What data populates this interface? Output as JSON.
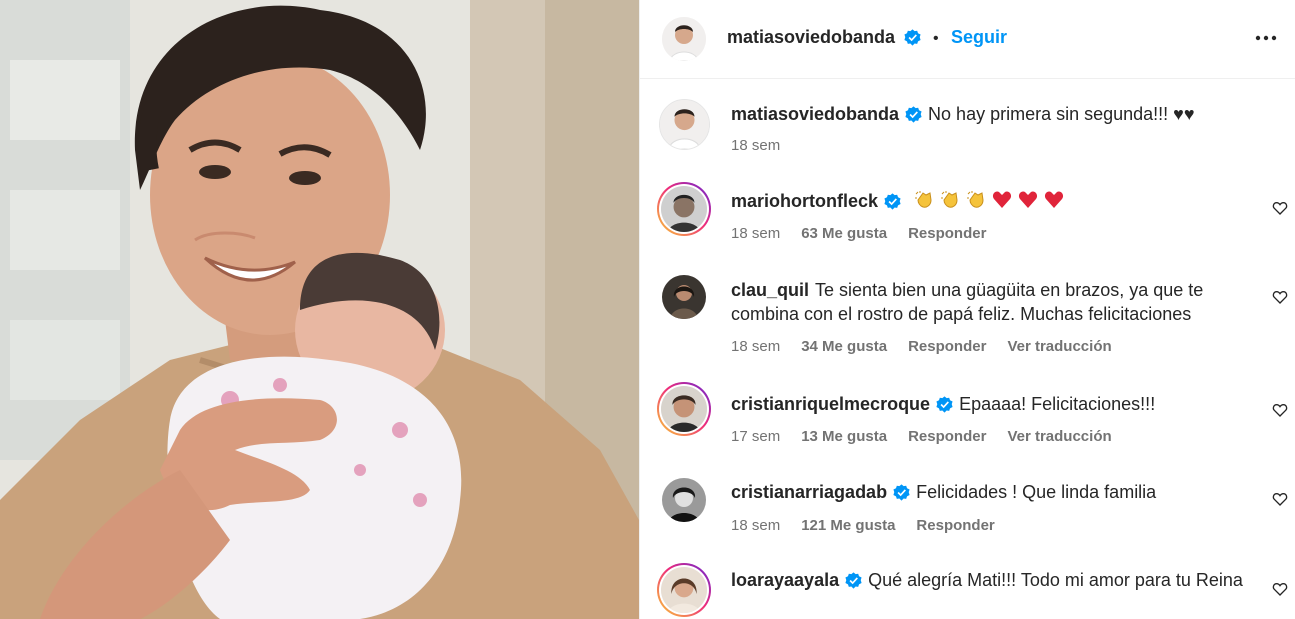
{
  "post": {
    "author": "matiasoviedobanda",
    "follow_label": "Seguir",
    "separator": "•",
    "caption": "No hay primera sin segunda!!! ♥♥",
    "time": "18 sem",
    "photo_alt": "Photo"
  },
  "comments": [
    {
      "username": "mariohortonfleck",
      "verified": true,
      "text": "",
      "emoji": [
        "clapping-hands",
        "clapping-hands",
        "clapping-hands",
        "red-heart",
        "red-heart",
        "red-heart"
      ],
      "time": "18 sem",
      "likes": "63 Me gusta",
      "reply": "Responder",
      "translate": ""
    },
    {
      "username": "clau_quil",
      "verified": false,
      "text": "Te sienta bien una güagüita en brazos, ya que te combina con el rostro de papá feliz. Muchas felicitaciones",
      "time": "18 sem",
      "likes": "34 Me gusta",
      "reply": "Responder",
      "translate": "Ver traducción"
    },
    {
      "username": "cristianriquelmecroque",
      "verified": true,
      "text": "Epaaaa! Felicitaciones!!!",
      "time": "17 sem",
      "likes": "13 Me gusta",
      "reply": "Responder",
      "translate": "Ver traducción"
    },
    {
      "username": "cristianarriagadab",
      "verified": true,
      "text": "Felicidades ! Que linda familia",
      "time": "18 sem",
      "likes": "121 Me gusta",
      "reply": "Responder",
      "translate": ""
    },
    {
      "username": "loarayaayala",
      "verified": true,
      "text": "Qué alegría Mati!!! Todo mi amor para tu Reina",
      "time": "",
      "likes": "",
      "reply": "",
      "translate": ""
    }
  ],
  "colors": {
    "link_blue": "#0095f6",
    "verified_blue": "#0095f6",
    "meta_gray": "#737373",
    "text": "#262626",
    "divider": "#efefef"
  },
  "icons": {
    "more": "more-options-icon",
    "heart": "heart-outline-icon",
    "verified": "verified-badge-icon"
  }
}
